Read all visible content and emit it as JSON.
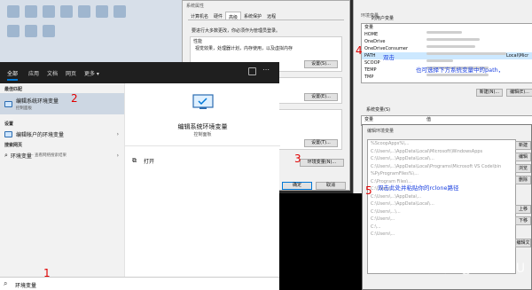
{
  "sysprop": {
    "title": "系统属性",
    "tabs": [
      "计算机名",
      "硬件",
      "高级",
      "系统保护",
      "远程"
    ],
    "admin_note": "要进行大多数更改，你必须作为管理员登录。",
    "perf_title": "性能",
    "perf_desc": "视觉效果，处理器计划，内存使用，以及虚拟内存",
    "settings_label": "设置(S)...",
    "settings_label2": "设置(E)...",
    "settings_label3": "设置(T)...",
    "env_button": "环境变量(N)...",
    "ok_label": "确定",
    "cancel_label": "取消"
  },
  "envvars": {
    "title": "环境变量",
    "user_vars_header": "的用户变量",
    "col_var": "变量",
    "col_val": "值",
    "user_vars": [
      "HOME",
      "OneDrive",
      "OneDriveConsumer",
      "PATH",
      "SCOOP",
      "TEMP",
      "TMP"
    ],
    "path_value_tail": "Local\\Micr",
    "new_label": "新建(N)...",
    "edit_label": "编辑(E)...",
    "sys_vars_header": "系统变量(S)",
    "sys_col_var": "变量",
    "sys_col_val": "值"
  },
  "editdlg": {
    "title": "编辑环境变量",
    "paths": [
      "%ScoopApps%\\...",
      "C:\\Users\\...\\AppData\\Local\\Microsoft\\WindowsApps",
      "C:\\Users\\...\\AppData\\Local\\...",
      "C:\\Users\\...\\AppData\\Local\\Programs\\Microsoft VS Code\\bin",
      "%PyProgramFiles%\\...",
      "C:\\Program Files\\...",
      "C:\\Users\\...",
      "C:\\Users\\...\\AppData\\...",
      "C:\\Users\\...\\AppData\\Local\\...",
      "C:\\Users\\...\\...",
      "C:\\Users\\...",
      "C:\\...",
      "C:\\Users\\..."
    ],
    "side_buttons": [
      "新建",
      "编辑",
      "浏览",
      "删除",
      "上移",
      "下移",
      "编辑文本"
    ]
  },
  "startmenu": {
    "tabs": [
      "全部",
      "应用",
      "文档",
      "网页",
      "更多 ▾"
    ],
    "best_match_header": "最佳匹配",
    "best_item": "编辑系统环境变量",
    "best_item_sub": "控制面板",
    "settings_header": "设置",
    "settings_item": "编辑帐户的环境变量",
    "web_header": "搜索网页",
    "web_item": "环境变量",
    "web_item_sub": " - 查看网络搜索结果",
    "right_title": "编辑系统环境变量",
    "right_sub": "控制面板",
    "open_label": "打开",
    "search_value": "环境变量"
  },
  "annotations": {
    "n1": "1",
    "n2": "2",
    "n3": "3",
    "n4": "4",
    "n5": "5",
    "note4a": "双击",
    "note4b": "也可选择下方系统变量中的path，",
    "note5": "双击此处并粘贴你的rclone路径"
  },
  "watermark": "知乎 @LAN DU",
  "colors": {
    "accent": "#0078d7",
    "annotation_red": "#e00000",
    "annotation_blue": "#1a40e0",
    "best_match_bg": "#cdd7e3"
  }
}
